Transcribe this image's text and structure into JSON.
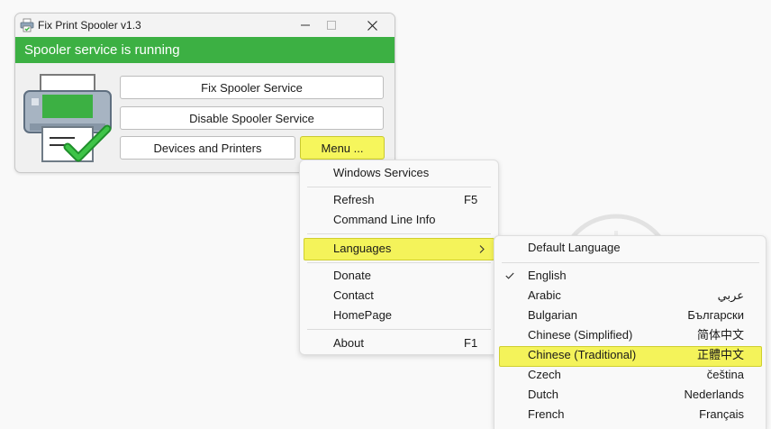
{
  "window": {
    "title": "Fix Print Spooler v1.3",
    "status_text": "Spooler service is running",
    "status_color": "#3cb043"
  },
  "buttons": {
    "fix": "Fix Spooler Service",
    "disable": "Disable Spooler Service",
    "devices": "Devices and Printers",
    "menu": "Menu ..."
  },
  "main_menu": {
    "windows_services": "Windows Services",
    "refresh": "Refresh",
    "refresh_shortcut": "F5",
    "command_line_info": "Command Line Info",
    "languages": "Languages",
    "donate": "Donate",
    "contact": "Contact",
    "homepage": "HomePage",
    "about": "About",
    "about_shortcut": "F1"
  },
  "language_menu": {
    "default": "Default Language",
    "items": [
      {
        "name": "English",
        "native": "",
        "checked": true
      },
      {
        "name": "Arabic",
        "native": "عربي"
      },
      {
        "name": "Bulgarian",
        "native": "Български"
      },
      {
        "name": "Chinese (Simplified)",
        "native": "简体中文"
      },
      {
        "name": "Chinese (Traditional)",
        "native": "正體中文",
        "highlighted": true
      },
      {
        "name": "Czech",
        "native": "čeština"
      },
      {
        "name": "Dutch",
        "native": "Nederlands"
      },
      {
        "name": "French",
        "native": "Français"
      }
    ]
  },
  "icons": {
    "app": "printer-app-icon",
    "minimize": "minimize-icon",
    "maximize": "maximize-icon",
    "close": "close-icon",
    "submenu": "chevron-right-icon",
    "check": "checkmark-icon"
  },
  "colors": {
    "highlight": "#f4f35a",
    "accent_green": "#3cb043"
  }
}
